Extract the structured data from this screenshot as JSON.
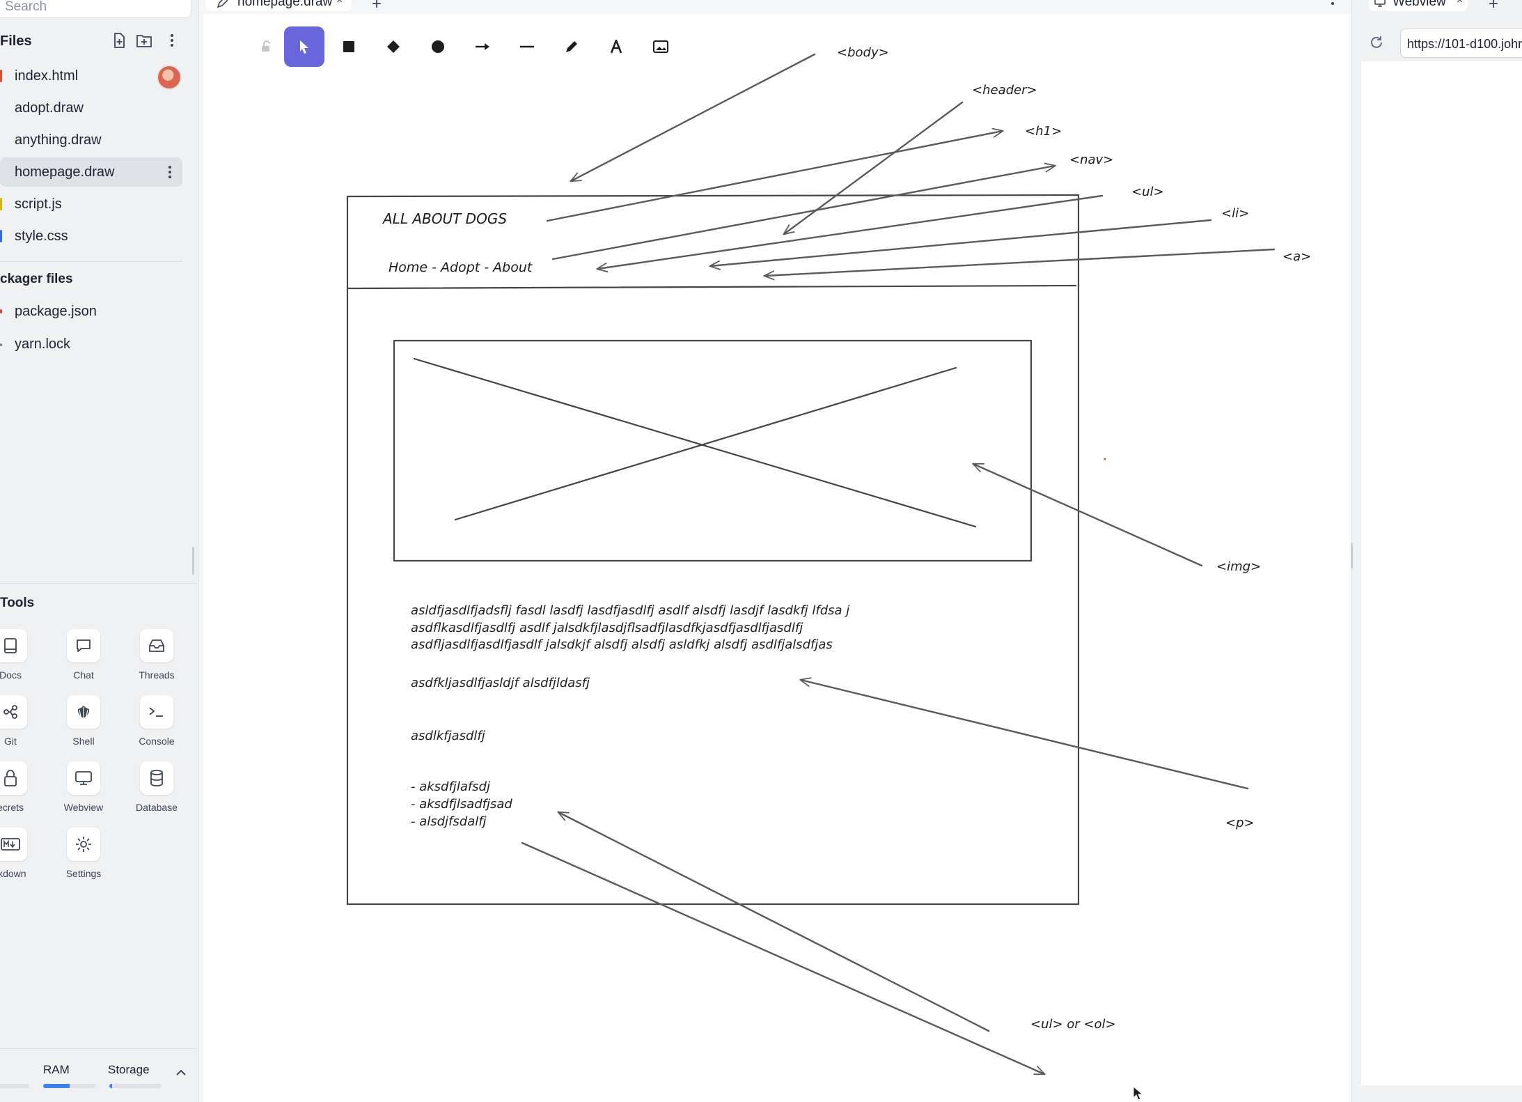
{
  "search": {
    "placeholder": "Search"
  },
  "files": {
    "title": "Files",
    "items": [
      {
        "name": "index.html",
        "color": "#e44d26"
      },
      {
        "name": "adopt.draw",
        "color": ""
      },
      {
        "name": "anything.draw",
        "color": ""
      },
      {
        "name": "homepage.draw",
        "color": "",
        "active": true
      },
      {
        "name": "script.js",
        "color": "#d9b400"
      },
      {
        "name": "style.css",
        "color": "#2f6df0"
      }
    ],
    "packager_title": "ckager files",
    "packager_items": [
      {
        "name": "package.json",
        "color": "#e0443a"
      },
      {
        "name": "yarn.lock",
        "color": "#7a7f8c"
      }
    ]
  },
  "tools": {
    "title": "Tools",
    "items": [
      {
        "label": "Docs",
        "icon": "docs-icon"
      },
      {
        "label": "Chat",
        "icon": "chat-icon"
      },
      {
        "label": "Threads",
        "icon": "threads-icon"
      },
      {
        "label": "Git",
        "icon": "git-icon"
      },
      {
        "label": "Shell",
        "icon": "shell-icon"
      },
      {
        "label": "Console",
        "icon": "console-icon"
      },
      {
        "label": "ecrets",
        "icon": "lock-icon"
      },
      {
        "label": "Webview",
        "icon": "monitor-icon"
      },
      {
        "label": "Database",
        "icon": "database-icon"
      },
      {
        "label": "rkdown",
        "icon": "markdown-icon"
      },
      {
        "label": "Settings",
        "icon": "gear-icon"
      }
    ]
  },
  "resources": {
    "ram_label": "RAM",
    "storage_label": "Storage",
    "ram_usage": 0.5,
    "storage_usage": 0.05
  },
  "editor": {
    "tab_label": "homepage.draw",
    "accent": "#6965db"
  },
  "sketch": {
    "h1_text": "ALL ABOUT DOGS",
    "nav_text": "Home - Adopt - About",
    "paragraph_lines": [
      "asldfjasdlfjadsflj fasdl lasdfj lasdfjasdlfj asdlf alsdfj lasdjf lasdkfj lfdsa j",
      "asdflkasdlfjasdlfj asdlf jalsdkfjlasdjflsadfjlasdfkjasdfjasdlfjasdlfj",
      "asdfljasdlfjasdlfjasdlf jalsdkjf alsdfj alsdfj asldfkj alsdfj asdlfjalsdfjas"
    ],
    "paragraph2": "asdfkljasdlfjasldjf alsdfjldasfj",
    "paragraph3": "asdlkfjasdlfj",
    "list_items": [
      "- aksdfjlafsdj",
      "- aksdfjlsadfjsad",
      "- alsdjfsdalfj"
    ],
    "annotations": {
      "body": "<body>",
      "header": "<header>",
      "h1": "<h1>",
      "nav": "<nav>",
      "ul": "<ul>",
      "li": "<li>",
      "a": "<a>",
      "img": "<img>",
      "p": "<p>",
      "list": "<ul> or <ol>"
    }
  },
  "webview": {
    "tab_label": "Webview",
    "url": "https://101-d100.johr"
  }
}
